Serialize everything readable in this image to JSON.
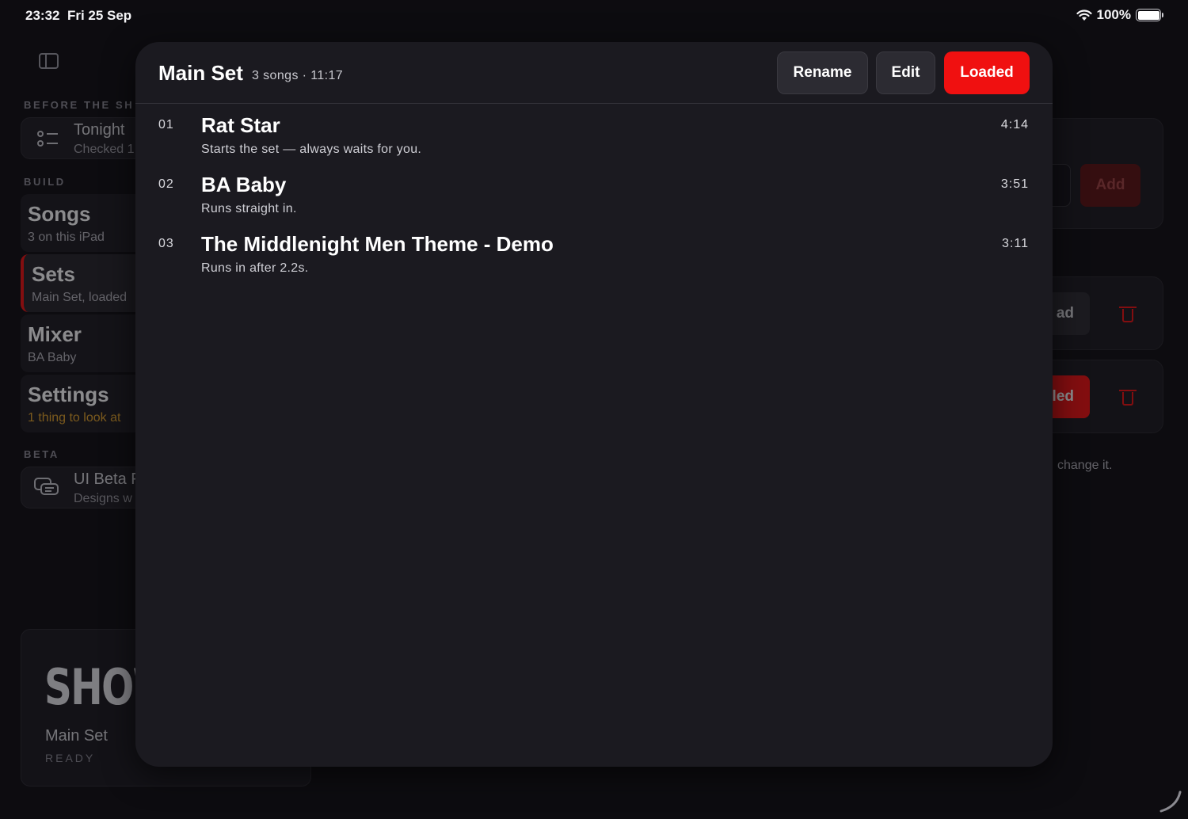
{
  "status_bar": {
    "time": "23:32",
    "date": "Fri 25 Sep",
    "battery": "100%"
  },
  "sidebar": {
    "sections": {
      "before": "BEFORE THE SH",
      "build": "BUILD",
      "beta": "BETA"
    },
    "tonight": {
      "title": "Tonight",
      "sub": "Checked 1"
    },
    "nav": [
      {
        "title": "Songs",
        "sub": "3 on this iPad"
      },
      {
        "title": "Sets",
        "sub": "Main Set, loaded"
      },
      {
        "title": "Mixer",
        "sub": "BA Baby"
      },
      {
        "title": "Settings",
        "sub": "1 thing to look at"
      }
    ],
    "beta_card": {
      "title": "UI Beta F",
      "sub": "Designs w"
    },
    "show_card": {
      "logo": "SHOW",
      "set": "Main Set",
      "status": "READY"
    }
  },
  "background_right": {
    "add_label": "Add",
    "load_fragment": "ad",
    "loaded_fragment": "led",
    "hint_fragment": "change it."
  },
  "modal": {
    "title": "Main Set",
    "meta": "3 songs · 11:17",
    "buttons": {
      "rename": "Rename",
      "edit": "Edit",
      "loaded": "Loaded"
    },
    "songs": [
      {
        "num": "01",
        "title": "Rat Star",
        "note": "Starts the set — always waits for you.",
        "duration": "4:14"
      },
      {
        "num": "02",
        "title": "BA Baby",
        "note": "Runs straight in.",
        "duration": "3:51"
      },
      {
        "num": "03",
        "title": "The Middlenight Men Theme - Demo",
        "note": "Runs in after 2.2s.",
        "duration": "3:11"
      }
    ]
  },
  "colors": {
    "accent": "#f01010",
    "background": "#0d0c10",
    "modal": "#1b1a20",
    "warning": "#d99a1e"
  }
}
